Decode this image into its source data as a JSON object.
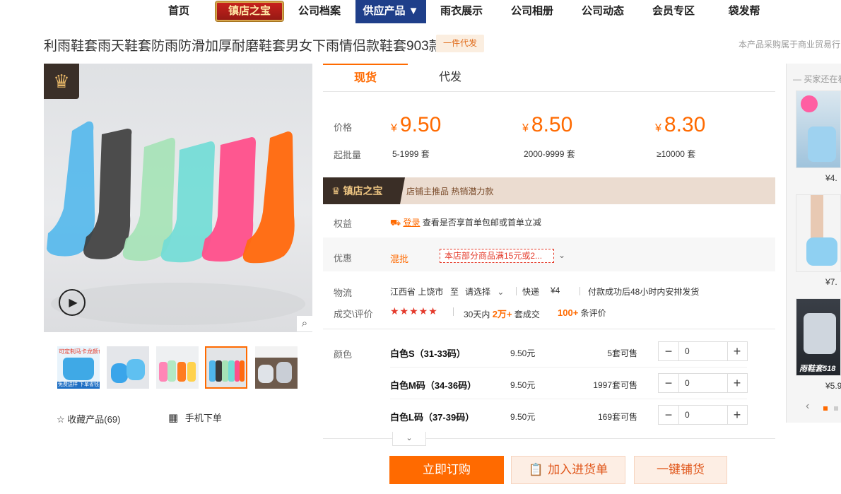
{
  "nav": {
    "items": [
      "首页",
      "公司档案",
      "供应产品 ▼",
      "雨衣展示",
      "公司相册",
      "公司动态",
      "会员专区",
      "袋发帮"
    ],
    "badge": "镇店之宝"
  },
  "product": {
    "title": "利雨鞋套雨天鞋套防雨防滑加厚耐磨鞋套男女下雨情侣款鞋套903款",
    "tag": "一件代发",
    "note": "本产品采购属于商业贸易行"
  },
  "gallery": {
    "favorite": "收藏产品(69)",
    "mobile": "手机下单",
    "thumb_text_1": "可定制马卡龙颜色",
    "thumb_text_2": "免费送样 下单省钱"
  },
  "tabs": [
    "现货",
    "代发"
  ],
  "pricing": {
    "price_label": "价格",
    "qty_label": "起批量",
    "currency": "¥",
    "tiers": [
      {
        "price": "9.50",
        "qty": "5-1999 套"
      },
      {
        "price": "8.50",
        "qty": "2000-9999 套"
      },
      {
        "price": "8.30",
        "qty": "≥10000 套"
      }
    ]
  },
  "promo": {
    "badge": "镇店之宝",
    "text": "店铺主推品   热销潜力款"
  },
  "benefits": {
    "label": "权益",
    "login": "登录",
    "text": "查看是否享首单包邮或首单立减"
  },
  "sale": {
    "label": "优惠",
    "type": "混批",
    "coupon": "本店部分商品满15元或2..."
  },
  "logistics": {
    "label": "物流",
    "from": "江西省 上饶市",
    "to_word": "至",
    "select": "请选择",
    "method": "快递",
    "fee": "¥4",
    "ship_note": "付款成功后48小时内安排发货"
  },
  "deal": {
    "label": "成交\\评价",
    "stars": "★★★★★",
    "days": "30天内",
    "count": "2万+",
    "count_suffix": "套成交",
    "reviews": "100+",
    "reviews_suffix": "条评价"
  },
  "variants": {
    "label": "颜色",
    "rows": [
      {
        "name": "白色S（31-33码）",
        "price": "9.50元",
        "stock": "5套可售",
        "qty": "0"
      },
      {
        "name": "白色M码（34-36码）",
        "price": "9.50元",
        "stock": "1997套可售",
        "qty": "0"
      },
      {
        "name": "白色L码（37-39码）",
        "price": "9.50元",
        "stock": "169套可售",
        "qty": "0"
      }
    ]
  },
  "actions": {
    "order": "立即订购",
    "cart": "加入进货单",
    "distribute": "一键铺货"
  },
  "sidebar": {
    "title": "买家还在看",
    "prices": [
      "¥4.",
      "¥7.",
      "¥5.9"
    ],
    "banner_text": "雨鞋套518"
  },
  "colors": {
    "accent": "#ff6a00",
    "nav_active": "#1f3f8a",
    "promo_bg": "#ebdcd0",
    "shoe_colors": [
      "#4fb6ec",
      "#3b3b3b",
      "#a6e3b6",
      "#72dcd6",
      "#ff4f8b",
      "#ff6a10"
    ]
  }
}
